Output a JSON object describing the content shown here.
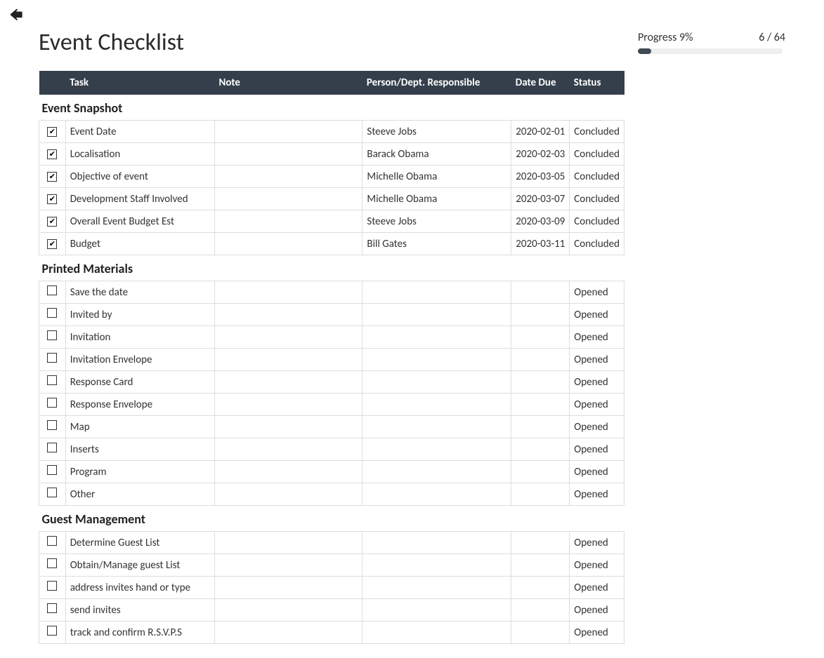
{
  "header": {
    "title": "Event Checklist",
    "progress_label": "Progress 9%",
    "progress_count": "6 / 64",
    "progress_percent": 9
  },
  "columns": {
    "task": "Task",
    "note": "Note",
    "person": "Person/Dept. Responsible",
    "date": "Date Due",
    "status": "Status"
  },
  "sections": [
    {
      "title": "Event Snapshot",
      "rows": [
        {
          "checked": true,
          "task": "Event Date",
          "note": "",
          "person": "Steeve Jobs",
          "date": "2020-02-01",
          "status": "Concluded"
        },
        {
          "checked": true,
          "task": "Localisation",
          "note": "",
          "person": "Barack Obama",
          "date": "2020-02-03",
          "status": "Concluded"
        },
        {
          "checked": true,
          "task": "Objective of event",
          "note": "",
          "person": "Michelle Obama",
          "date": "2020-03-05",
          "status": "Concluded"
        },
        {
          "checked": true,
          "task": "Development Staff Involved",
          "note": "",
          "person": "Michelle Obama",
          "date": "2020-03-07",
          "status": "Concluded"
        },
        {
          "checked": true,
          "task": "Overall Event Budget Est",
          "note": "",
          "person": "Steeve Jobs",
          "date": "2020-03-09",
          "status": "Concluded"
        },
        {
          "checked": true,
          "task": "Budget",
          "note": "",
          "person": "Bill Gates",
          "date": "2020-03-11",
          "status": "Concluded"
        }
      ]
    },
    {
      "title": "Printed Materials",
      "rows": [
        {
          "checked": false,
          "task": "Save the date",
          "note": "",
          "person": "",
          "date": "",
          "status": "Opened"
        },
        {
          "checked": false,
          "task": "Invited by",
          "note": "",
          "person": "",
          "date": "",
          "status": "Opened"
        },
        {
          "checked": false,
          "task": "Invitation",
          "note": "",
          "person": "",
          "date": "",
          "status": "Opened"
        },
        {
          "checked": false,
          "task": "Invitation Envelope",
          "note": "",
          "person": "",
          "date": "",
          "status": "Opened"
        },
        {
          "checked": false,
          "task": "Response Card",
          "note": "",
          "person": "",
          "date": "",
          "status": "Opened"
        },
        {
          "checked": false,
          "task": "Response Envelope",
          "note": "",
          "person": "",
          "date": "",
          "status": "Opened"
        },
        {
          "checked": false,
          "task": "Map",
          "note": "",
          "person": "",
          "date": "",
          "status": "Opened"
        },
        {
          "checked": false,
          "task": "Inserts",
          "note": "",
          "person": "",
          "date": "",
          "status": "Opened"
        },
        {
          "checked": false,
          "task": "Program",
          "note": "",
          "person": "",
          "date": "",
          "status": "Opened"
        },
        {
          "checked": false,
          "task": "Other",
          "note": "",
          "person": "",
          "date": "",
          "status": "Opened"
        }
      ]
    },
    {
      "title": "Guest Management",
      "rows": [
        {
          "checked": false,
          "task": "Determine Guest List",
          "note": "",
          "person": "",
          "date": "",
          "status": "Opened"
        },
        {
          "checked": false,
          "task": "Obtain/Manage guest List",
          "note": "",
          "person": "",
          "date": "",
          "status": "Opened"
        },
        {
          "checked": false,
          "task": "address invites hand or type",
          "note": "",
          "person": "",
          "date": "",
          "status": "Opened"
        },
        {
          "checked": false,
          "task": "send invites",
          "note": "",
          "person": "",
          "date": "",
          "status": "Opened"
        },
        {
          "checked": false,
          "task": "track and confirm R.S.V.P.S",
          "note": "",
          "person": "",
          "date": "",
          "status": "Opened"
        }
      ]
    }
  ]
}
